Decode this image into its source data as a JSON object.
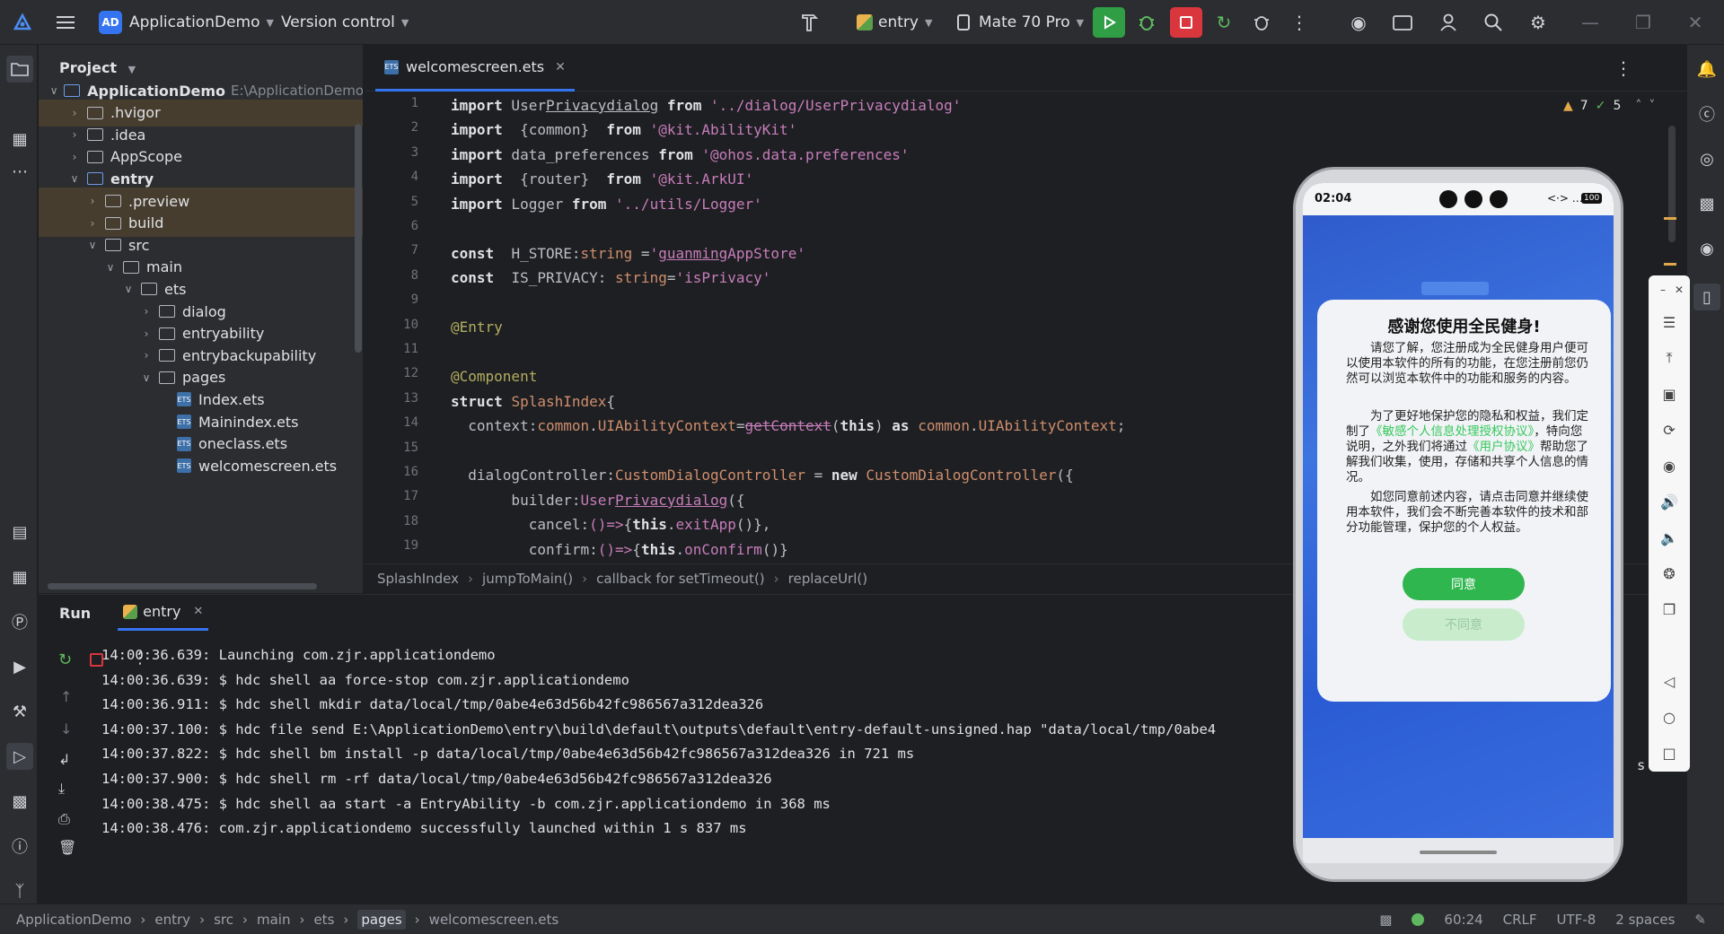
{
  "titlebar": {
    "project_badge": "AD",
    "project_name": "ApplicationDemo",
    "version_control": "Version control",
    "run_config": "entry",
    "device": "Mate 70 Pro"
  },
  "project_panel": {
    "title": "Project",
    "tree": [
      {
        "label": "ApplicationDemo",
        "extra": "E:\\ApplicationDemo",
        "indent": 0,
        "arrow": "v",
        "kind": "module",
        "bold": true
      },
      {
        "label": ".hvigor",
        "indent": 1,
        "arrow": ">",
        "kind": "folder",
        "hl": true
      },
      {
        "label": ".idea",
        "indent": 1,
        "arrow": ">",
        "kind": "folder"
      },
      {
        "label": "AppScope",
        "indent": 1,
        "arrow": ">",
        "kind": "folder"
      },
      {
        "label": "entry",
        "indent": 1,
        "arrow": "v",
        "kind": "module",
        "bold": true
      },
      {
        "label": ".preview",
        "indent": 2,
        "arrow": ">",
        "kind": "folder",
        "hl": true
      },
      {
        "label": "build",
        "indent": 2,
        "arrow": ">",
        "kind": "folder",
        "hl": true
      },
      {
        "label": "src",
        "indent": 2,
        "arrow": "v",
        "kind": "folder"
      },
      {
        "label": "main",
        "indent": 3,
        "arrow": "v",
        "kind": "folder"
      },
      {
        "label": "ets",
        "indent": 4,
        "arrow": "v",
        "kind": "folder"
      },
      {
        "label": "dialog",
        "indent": 5,
        "arrow": ">",
        "kind": "folder"
      },
      {
        "label": "entryability",
        "indent": 5,
        "arrow": ">",
        "kind": "folder"
      },
      {
        "label": "entrybackupability",
        "indent": 5,
        "arrow": ">",
        "kind": "folder"
      },
      {
        "label": "pages",
        "indent": 5,
        "arrow": "v",
        "kind": "folder"
      },
      {
        "label": "Index.ets",
        "indent": 6,
        "arrow": "",
        "kind": "file"
      },
      {
        "label": "Mainindex.ets",
        "indent": 6,
        "arrow": "",
        "kind": "file"
      },
      {
        "label": "oneclass.ets",
        "indent": 6,
        "arrow": "",
        "kind": "file"
      },
      {
        "label": "welcomescreen.ets",
        "indent": 6,
        "arrow": "",
        "kind": "file"
      }
    ]
  },
  "editor": {
    "tab_label": "welcomescreen.ets",
    "inspections": {
      "warnings": "7",
      "ok": "5"
    },
    "line_numbers": [
      "1",
      "2",
      "3",
      "4",
      "5",
      "6",
      "7",
      "8",
      "9",
      "10",
      "11",
      "12",
      "13",
      "14",
      "15",
      "16",
      "17",
      "18",
      "19"
    ],
    "breadcrumb": [
      "SplashIndex",
      "jumpToMain()",
      "callback for setTimeout()",
      "replaceUrl()"
    ]
  },
  "run_panel": {
    "title": "Run",
    "tab": "entry",
    "log": [
      "14:00:36.639: Launching com.zjr.applicationdemo",
      "14:00:36.639: $ hdc shell aa force-stop com.zjr.applicationdemo",
      "14:00:36.911: $ hdc shell mkdir data/local/tmp/0abe4e63d56b42fc986567a312dea326",
      "14:00:37.100: $ hdc file send E:\\ApplicationDemo\\entry\\build\\default\\outputs\\default\\entry-default-unsigned.hap \"data/local/tmp/0abe4",
      "14:00:37.822: $ hdc shell bm install -p data/local/tmp/0abe4e63d56b42fc986567a312dea326 in 721 ms",
      "14:00:37.900: $ hdc shell rm -rf data/local/tmp/0abe4e63d56b42fc986567a312dea326",
      "14:00:38.475: $ hdc shell aa start -a EntryAbility -b com.zjr.applicationdemo in 368 ms",
      "14:00:38.476: com.zjr.applicationdemo successfully launched within 1 s 837 ms"
    ],
    "log_trailing": "s"
  },
  "statusbar": {
    "path": [
      "ApplicationDemo",
      "entry",
      "src",
      "main",
      "ets",
      "pages",
      "welcomescreen.ets"
    ],
    "position": "60:24",
    "line_sep": "CRLF",
    "encoding": "UTF-8",
    "indent": "2 spaces"
  },
  "phone": {
    "time": "02:04",
    "battery": "100",
    "dialog": {
      "title": "感谢您使用全民健身!",
      "p1": "请您了解，您注册成为全民健身用户便可以使用本软件的所有的功能，在您注册前您仍然可以浏览本软件中的功能和服务的内容。",
      "p2_a": "为了更好地保护您的隐私和权益，我们定制了",
      "p2_link1": "《敏感个人信息处理授权协议》",
      "p2_b": "，特向您说明，之外我们将通过",
      "p2_link2": "《用户协议》",
      "p2_c": "帮助您了解我们收集，使用，存储和共享个人信息的情况。",
      "p3": "如您同意前述内容，请点击同意并继续使用本软件，我们会不断完善本软件的技术和部分功能管理，保护您的个人权益。",
      "agree": "同意",
      "disagree": "不同意"
    }
  },
  "colors": {
    "accent": "#3574f0",
    "run_green": "#2f9e44",
    "stop_red": "#d9363e",
    "link_green": "#35c85c"
  }
}
